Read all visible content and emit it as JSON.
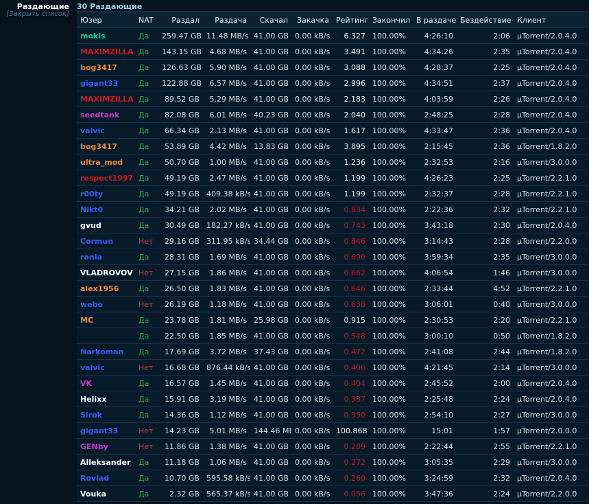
{
  "sidebar": {
    "title": "Раздающие",
    "close_label": "[Закрыть список]"
  },
  "count_label": "30 Раздающие",
  "columns": [
    "Юзер",
    "NAT",
    "Раздал",
    "Раздача",
    "Скачал",
    "Закачка",
    "Рейтинг",
    "Закончил",
    "В раздаче",
    "Бездействие",
    "Клиент"
  ],
  "colors": {
    "yes": "#2ea84a",
    "no": "#e53030",
    "low_rating": "#c21c1c"
  },
  "rows": [
    {
      "user": "mokis",
      "color": "#00d19a",
      "nat": "Да",
      "uploaded": "259.47 GB",
      "up_speed": "11.48 MB/s",
      "downloaded": "41.00 GB",
      "down_speed": "0.00 kB/s",
      "rating": "6.327",
      "low": false,
      "done": "100.00%",
      "seeding": "4:26:10",
      "idle": "2:06",
      "client": "µTorrent/2.0.4.0"
    },
    {
      "user": "MAXIMZILLA",
      "color": "#c81c1c",
      "nat": "Да",
      "uploaded": "143.15 GB",
      "up_speed": "4.68 MB/s",
      "downloaded": "41.00 GB",
      "down_speed": "0.00 kB/s",
      "rating": "3.491",
      "low": false,
      "done": "100.00%",
      "seeding": "4:34:26",
      "idle": "2:35",
      "client": "µTorrent/2.0.4.0"
    },
    {
      "user": "bog3417",
      "color": "#f08a3a",
      "nat": "Да",
      "uploaded": "126.63 GB",
      "up_speed": "5.90 MB/s",
      "downloaded": "41.00 GB",
      "down_speed": "0.00 kB/s",
      "rating": "3.088",
      "low": false,
      "done": "100.00%",
      "seeding": "4:28:37",
      "idle": "2:25",
      "client": "µTorrent/2.0.4.0"
    },
    {
      "user": "gigant33",
      "color": "#3a5cf0",
      "nat": "Да",
      "uploaded": "122.88 GB",
      "up_speed": "6.57 MB/s",
      "downloaded": "41.00 GB",
      "down_speed": "0.00 kB/s",
      "rating": "2.996",
      "low": false,
      "done": "100.00%",
      "seeding": "4:34:51",
      "idle": "2:37",
      "client": "µTorrent/2.0.4.0"
    },
    {
      "user": "MAXIMZILLA",
      "color": "#c81c1c",
      "nat": "Да",
      "uploaded": "89.52 GB",
      "up_speed": "5.29 MB/s",
      "downloaded": "41.00 GB",
      "down_speed": "0.00 kB/s",
      "rating": "2.183",
      "low": false,
      "done": "100.00%",
      "seeding": "4:03:59",
      "idle": "2:26",
      "client": "µTorrent/2.0.4.0"
    },
    {
      "user": "seedtank",
      "color": "#c83cc8",
      "nat": "Да",
      "uploaded": "82.08 GB",
      "up_speed": "6.01 MB/s",
      "downloaded": "40.23 GB",
      "down_speed": "0.00 kB/s",
      "rating": "2.040",
      "low": false,
      "done": "100.00%",
      "seeding": "2:48:25",
      "idle": "2:28",
      "client": "µTorrent/2.0.4.0"
    },
    {
      "user": "valvic",
      "color": "#3a5cf0",
      "nat": "Да",
      "uploaded": "66.34 GB",
      "up_speed": "2.13 MB/s",
      "downloaded": "41.00 GB",
      "down_speed": "0.00 kB/s",
      "rating": "1.617",
      "low": false,
      "done": "100.00%",
      "seeding": "4:33:47",
      "idle": "2:36",
      "client": "µTorrent/2.0.4.0"
    },
    {
      "user": "bog3417",
      "color": "#f08a3a",
      "nat": "Да",
      "uploaded": "53.89 GB",
      "up_speed": "4.42 MB/s",
      "downloaded": "13.83 GB",
      "down_speed": "0.00 kB/s",
      "rating": "3.895",
      "low": false,
      "done": "100.00%",
      "seeding": "2:15:45",
      "idle": "2:36",
      "client": "µTorrent/1.8.2.0"
    },
    {
      "user": "ultra_mod",
      "color": "#f08a3a",
      "nat": "Да",
      "uploaded": "50.70 GB",
      "up_speed": "1.00 MB/s",
      "downloaded": "41.00 GB",
      "down_speed": "0.00 kB/s",
      "rating": "1.236",
      "low": false,
      "done": "100.00%",
      "seeding": "2:32:53",
      "idle": "2:16",
      "client": "µTorrent/3.0.0.0"
    },
    {
      "user": "respect1997",
      "color": "#c81c1c",
      "nat": "Да",
      "uploaded": "49.19 GB",
      "up_speed": "2.47 MB/s",
      "downloaded": "41.00 GB",
      "down_speed": "0.00 kB/s",
      "rating": "1.199",
      "low": false,
      "done": "100.00%",
      "seeding": "4:26:23",
      "idle": "2:25",
      "client": "µTorrent/2.2.1.0"
    },
    {
      "user": "r00ty",
      "color": "#3a5cf0",
      "nat": "Да",
      "uploaded": "49.19 GB",
      "up_speed": "409.38 kB/s",
      "downloaded": "41.00 GB",
      "down_speed": "0.00 kB/s",
      "rating": "1.199",
      "low": false,
      "done": "100.00%",
      "seeding": "2:32:37",
      "idle": "2:28",
      "client": "µTorrent/2.2.1.0"
    },
    {
      "user": "Nikt0",
      "color": "#3a5cf0",
      "nat": "Да",
      "uploaded": "34.21 GB",
      "up_speed": "2.02 MB/s",
      "downloaded": "41.00 GB",
      "down_speed": "0.00 kB/s",
      "rating": "0.834",
      "low": true,
      "done": "100.00%",
      "seeding": "2:22:36",
      "idle": "2:32",
      "client": "µTorrent/2.2.1.0"
    },
    {
      "user": "gvud",
      "color": "#ffffff",
      "nat": "Да",
      "uploaded": "30.49 GB",
      "up_speed": "182.27 kB/s",
      "downloaded": "41.00 GB",
      "down_speed": "0.00 kB/s",
      "rating": "0.743",
      "low": true,
      "done": "100.00%",
      "seeding": "3:43:18",
      "idle": "2:30",
      "client": "µTorrent/2.0.4.0"
    },
    {
      "user": "Cormun",
      "color": "#3a5cf0",
      "nat": "Нет",
      "uploaded": "29.16 GB",
      "up_speed": "311.95 kB/s",
      "downloaded": "34.44 GB",
      "down_speed": "0.00 kB/s",
      "rating": "0.846",
      "low": true,
      "done": "100.00%",
      "seeding": "3:14:43",
      "idle": "2:28",
      "client": "µTorrent/2.2.0.0"
    },
    {
      "user": "ronia",
      "color": "#3a5cf0",
      "nat": "Да",
      "uploaded": "28.31 GB",
      "up_speed": "1.69 MB/s",
      "downloaded": "41.00 GB",
      "down_speed": "0.00 kB/s",
      "rating": "0.690",
      "low": true,
      "done": "100.00%",
      "seeding": "3:59:34",
      "idle": "2:35",
      "client": "µTorrent/3.0.0.0"
    },
    {
      "user": "VLADROVOV",
      "color": "#ffffff",
      "nat": "Нет",
      "uploaded": "27.15 GB",
      "up_speed": "1.86 MB/s",
      "downloaded": "41.00 GB",
      "down_speed": "0.00 kB/s",
      "rating": "0.662",
      "low": true,
      "done": "100.00%",
      "seeding": "4:06:54",
      "idle": "1:46",
      "client": "µTorrent/3.0.0.0"
    },
    {
      "user": "alex1956",
      "color": "#f08a3a",
      "nat": "Да",
      "uploaded": "26.50 GB",
      "up_speed": "1.83 MB/s",
      "downloaded": "41.00 GB",
      "down_speed": "0.00 kB/s",
      "rating": "0.646",
      "low": true,
      "done": "100.00%",
      "seeding": "2:33:44",
      "idle": "4:52",
      "client": "µTorrent/2.2.1.0"
    },
    {
      "user": "webo",
      "color": "#3a5cf0",
      "nat": "Нет",
      "uploaded": "26.19 GB",
      "up_speed": "1.18 MB/s",
      "downloaded": "41.00 GB",
      "down_speed": "0.00 kB/s",
      "rating": "0.638",
      "low": true,
      "done": "100.00%",
      "seeding": "3:06:01",
      "idle": "0:40",
      "client": "µTorrent/3.0.0.0"
    },
    {
      "user": "MC",
      "color": "#f08a3a",
      "nat": "Да",
      "uploaded": "23.78 GB",
      "up_speed": "1.81 MB/s",
      "downloaded": "25.98 GB",
      "down_speed": "0.00 kB/s",
      "rating": "0.915",
      "low": false,
      "done": "100.00%",
      "seeding": "2:30:53",
      "idle": "2:20",
      "client": "µTorrent/2.2.1.0"
    },
    {
      "user": "",
      "color": "#3a5cf0",
      "nat": "Да",
      "uploaded": "22.50 GB",
      "up_speed": "1.85 MB/s",
      "downloaded": "41.00 GB",
      "down_speed": "0.00 kB/s",
      "rating": "0.548",
      "low": true,
      "done": "100.00%",
      "seeding": "3:00:10",
      "idle": "0:50",
      "client": "µTorrent/1.8.2.0"
    },
    {
      "user": "Narkoman",
      "color": "#3a5cf0",
      "nat": "Да",
      "uploaded": "17.69 GB",
      "up_speed": "3.72 MB/s",
      "downloaded": "37.43 GB",
      "down_speed": "0.00 kB/s",
      "rating": "0.472",
      "low": true,
      "done": "100.00%",
      "seeding": "2:41:08",
      "idle": "2:44",
      "client": "µTorrent/1.8.2.0"
    },
    {
      "user": "valvic",
      "color": "#3a5cf0",
      "nat": "Нет",
      "uploaded": "16.68 GB",
      "up_speed": "876.44 kB/s",
      "downloaded": "41.00 GB",
      "down_speed": "0.00 kB/s",
      "rating": "0.406",
      "low": true,
      "done": "100.00%",
      "seeding": "4:21:45",
      "idle": "2:14",
      "client": "µTorrent/3.0.0.0"
    },
    {
      "user": "VK",
      "color": "#c83cc8",
      "nat": "Да",
      "uploaded": "16.57 GB",
      "up_speed": "1.45 MB/s",
      "downloaded": "41.00 GB",
      "down_speed": "0.00 kB/s",
      "rating": "0.404",
      "low": true,
      "done": "100.00%",
      "seeding": "2:45:52",
      "idle": "2:00",
      "client": "µTorrent/2.0.4.0"
    },
    {
      "user": "Helixx",
      "color": "#ffffff",
      "nat": "Да",
      "uploaded": "15.91 GB",
      "up_speed": "3.19 MB/s",
      "downloaded": "41.00 GB",
      "down_speed": "0.00 kB/s",
      "rating": "0.387",
      "low": true,
      "done": "100.00%",
      "seeding": "2:25:48",
      "idle": "2:24",
      "client": "µTorrent/2.0.4.0"
    },
    {
      "user": "Sirok",
      "color": "#3a5cf0",
      "nat": "Да",
      "uploaded": "14.36 GB",
      "up_speed": "1.12 MB/s",
      "downloaded": "41.00 GB",
      "down_speed": "0.00 kB/s",
      "rating": "0.350",
      "low": true,
      "done": "100.00%",
      "seeding": "2:54:10",
      "idle": "2:27",
      "client": "µTorrent/3.0.0.0"
    },
    {
      "user": "gigant33",
      "color": "#3a5cf0",
      "nat": "Нет",
      "uploaded": "14.23 GB",
      "up_speed": "5.01 MB/s",
      "downloaded": "144.46 MB",
      "down_speed": "0.00 kB/s",
      "rating": "100.868",
      "low": false,
      "done": "100.00%",
      "seeding": "15:01",
      "idle": "1:57",
      "client": "µTorrent/2.0.0.0"
    },
    {
      "user": "GENby",
      "color": "#c83cc8",
      "nat": "Нет",
      "uploaded": "11.86 GB",
      "up_speed": "1.38 MB/s",
      "downloaded": "41.00 GB",
      "down_speed": "0.00 kB/s",
      "rating": "0.289",
      "low": true,
      "done": "100.00%",
      "seeding": "2:22:44",
      "idle": "2:55",
      "client": "µTorrent/2.2.1.0"
    },
    {
      "user": "Alleksander",
      "color": "#ffffff",
      "nat": "Да",
      "uploaded": "11.18 GB",
      "up_speed": "1.06 MB/s",
      "downloaded": "41.00 GB",
      "down_speed": "0.00 kB/s",
      "rating": "0.272",
      "low": true,
      "done": "100.00%",
      "seeding": "3:05:35",
      "idle": "2:29",
      "client": "µTorrent/3.0.0.0"
    },
    {
      "user": "Rovlad",
      "color": "#3a5cf0",
      "nat": "Да",
      "uploaded": "10.70 GB",
      "up_speed": "595.58 kB/s",
      "downloaded": "41.00 GB",
      "down_speed": "0.00 kB/s",
      "rating": "0.260",
      "low": true,
      "done": "100.00%",
      "seeding": "3:24:59",
      "idle": "2:32",
      "client": "µTorrent/2.0.4.0"
    },
    {
      "user": "Vouka",
      "color": "#ffffff",
      "nat": "Да",
      "uploaded": "2.32 GB",
      "up_speed": "565.37 kB/s",
      "downloaded": "41.00 GB",
      "down_speed": "0.00 kB/s",
      "rating": "0.056",
      "low": true,
      "done": "100.00%",
      "seeding": "3:47:36",
      "idle": "2:24",
      "client": "µTorrent/2.2.0.0"
    }
  ]
}
